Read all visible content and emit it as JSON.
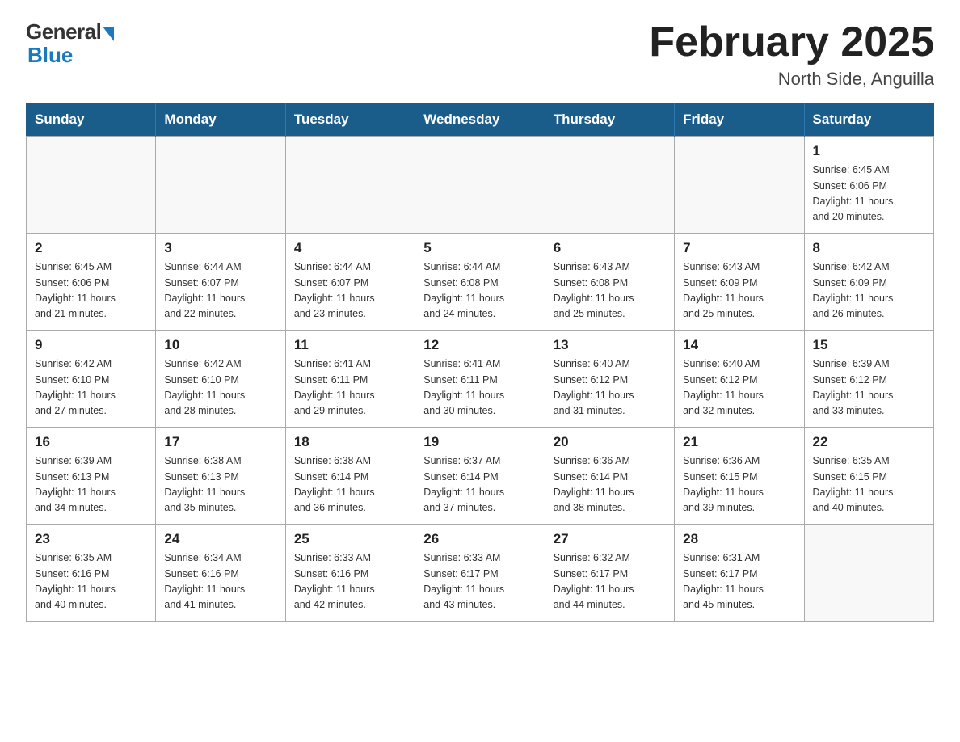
{
  "logo": {
    "general": "General",
    "blue": "Blue"
  },
  "header": {
    "title": "February 2025",
    "location": "North Side, Anguilla"
  },
  "weekdays": [
    "Sunday",
    "Monday",
    "Tuesday",
    "Wednesday",
    "Thursday",
    "Friday",
    "Saturday"
  ],
  "weeks": [
    [
      {
        "day": "",
        "info": ""
      },
      {
        "day": "",
        "info": ""
      },
      {
        "day": "",
        "info": ""
      },
      {
        "day": "",
        "info": ""
      },
      {
        "day": "",
        "info": ""
      },
      {
        "day": "",
        "info": ""
      },
      {
        "day": "1",
        "info": "Sunrise: 6:45 AM\nSunset: 6:06 PM\nDaylight: 11 hours\nand 20 minutes."
      }
    ],
    [
      {
        "day": "2",
        "info": "Sunrise: 6:45 AM\nSunset: 6:06 PM\nDaylight: 11 hours\nand 21 minutes."
      },
      {
        "day": "3",
        "info": "Sunrise: 6:44 AM\nSunset: 6:07 PM\nDaylight: 11 hours\nand 22 minutes."
      },
      {
        "day": "4",
        "info": "Sunrise: 6:44 AM\nSunset: 6:07 PM\nDaylight: 11 hours\nand 23 minutes."
      },
      {
        "day": "5",
        "info": "Sunrise: 6:44 AM\nSunset: 6:08 PM\nDaylight: 11 hours\nand 24 minutes."
      },
      {
        "day": "6",
        "info": "Sunrise: 6:43 AM\nSunset: 6:08 PM\nDaylight: 11 hours\nand 25 minutes."
      },
      {
        "day": "7",
        "info": "Sunrise: 6:43 AM\nSunset: 6:09 PM\nDaylight: 11 hours\nand 25 minutes."
      },
      {
        "day": "8",
        "info": "Sunrise: 6:42 AM\nSunset: 6:09 PM\nDaylight: 11 hours\nand 26 minutes."
      }
    ],
    [
      {
        "day": "9",
        "info": "Sunrise: 6:42 AM\nSunset: 6:10 PM\nDaylight: 11 hours\nand 27 minutes."
      },
      {
        "day": "10",
        "info": "Sunrise: 6:42 AM\nSunset: 6:10 PM\nDaylight: 11 hours\nand 28 minutes."
      },
      {
        "day": "11",
        "info": "Sunrise: 6:41 AM\nSunset: 6:11 PM\nDaylight: 11 hours\nand 29 minutes."
      },
      {
        "day": "12",
        "info": "Sunrise: 6:41 AM\nSunset: 6:11 PM\nDaylight: 11 hours\nand 30 minutes."
      },
      {
        "day": "13",
        "info": "Sunrise: 6:40 AM\nSunset: 6:12 PM\nDaylight: 11 hours\nand 31 minutes."
      },
      {
        "day": "14",
        "info": "Sunrise: 6:40 AM\nSunset: 6:12 PM\nDaylight: 11 hours\nand 32 minutes."
      },
      {
        "day": "15",
        "info": "Sunrise: 6:39 AM\nSunset: 6:12 PM\nDaylight: 11 hours\nand 33 minutes."
      }
    ],
    [
      {
        "day": "16",
        "info": "Sunrise: 6:39 AM\nSunset: 6:13 PM\nDaylight: 11 hours\nand 34 minutes."
      },
      {
        "day": "17",
        "info": "Sunrise: 6:38 AM\nSunset: 6:13 PM\nDaylight: 11 hours\nand 35 minutes."
      },
      {
        "day": "18",
        "info": "Sunrise: 6:38 AM\nSunset: 6:14 PM\nDaylight: 11 hours\nand 36 minutes."
      },
      {
        "day": "19",
        "info": "Sunrise: 6:37 AM\nSunset: 6:14 PM\nDaylight: 11 hours\nand 37 minutes."
      },
      {
        "day": "20",
        "info": "Sunrise: 6:36 AM\nSunset: 6:14 PM\nDaylight: 11 hours\nand 38 minutes."
      },
      {
        "day": "21",
        "info": "Sunrise: 6:36 AM\nSunset: 6:15 PM\nDaylight: 11 hours\nand 39 minutes."
      },
      {
        "day": "22",
        "info": "Sunrise: 6:35 AM\nSunset: 6:15 PM\nDaylight: 11 hours\nand 40 minutes."
      }
    ],
    [
      {
        "day": "23",
        "info": "Sunrise: 6:35 AM\nSunset: 6:16 PM\nDaylight: 11 hours\nand 40 minutes."
      },
      {
        "day": "24",
        "info": "Sunrise: 6:34 AM\nSunset: 6:16 PM\nDaylight: 11 hours\nand 41 minutes."
      },
      {
        "day": "25",
        "info": "Sunrise: 6:33 AM\nSunset: 6:16 PM\nDaylight: 11 hours\nand 42 minutes."
      },
      {
        "day": "26",
        "info": "Sunrise: 6:33 AM\nSunset: 6:17 PM\nDaylight: 11 hours\nand 43 minutes."
      },
      {
        "day": "27",
        "info": "Sunrise: 6:32 AM\nSunset: 6:17 PM\nDaylight: 11 hours\nand 44 minutes."
      },
      {
        "day": "28",
        "info": "Sunrise: 6:31 AM\nSunset: 6:17 PM\nDaylight: 11 hours\nand 45 minutes."
      },
      {
        "day": "",
        "info": ""
      }
    ]
  ]
}
